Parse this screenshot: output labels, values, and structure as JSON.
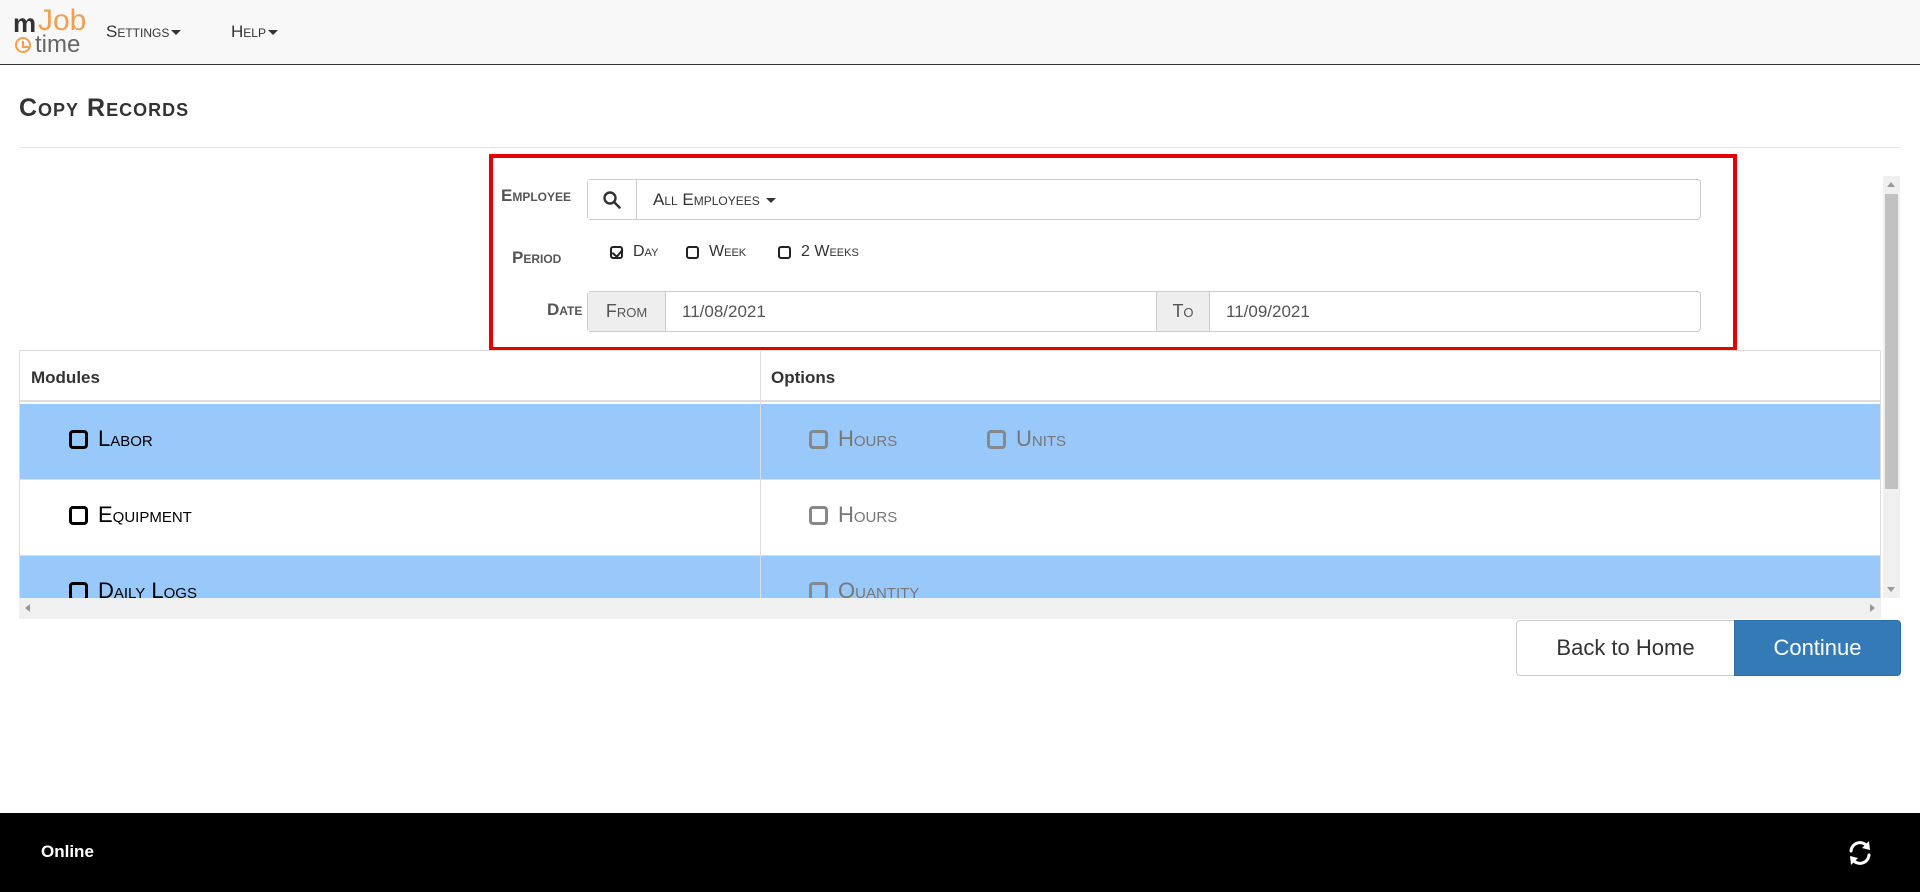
{
  "app": {
    "logo_m": "m",
    "logo_job": "Job",
    "logo_time": "time"
  },
  "nav": {
    "settings": "Settings",
    "help": "Help"
  },
  "page": {
    "title": "Copy Records"
  },
  "filters": {
    "employee_label": "Employee",
    "employee_value": "All Employees",
    "period_label": "Period",
    "period_options": [
      {
        "label": "Day",
        "checked": true
      },
      {
        "label": "Week",
        "checked": false
      },
      {
        "label": "2 Weeks",
        "checked": false
      }
    ],
    "date_label": "Date",
    "from_label": "From",
    "from_value": "11/08/2021",
    "to_label": "To",
    "to_value": "11/09/2021"
  },
  "table": {
    "headers": [
      "Modules",
      "Options"
    ],
    "rows": [
      {
        "module": "Labor",
        "options": [
          "Hours",
          "Units"
        ]
      },
      {
        "module": "Equipment",
        "options": [
          "Hours"
        ]
      },
      {
        "module": "Daily Logs",
        "options": [
          "Quantity"
        ]
      }
    ]
  },
  "buttons": {
    "back": "Back to Home",
    "continue": "Continue"
  },
  "footer": {
    "status": "Online"
  },
  "icons": {
    "search": "search-icon",
    "sync": "refresh-icon",
    "accent": "#e60000",
    "primary": "#337ab7",
    "row_highlight": "#99c8fb"
  }
}
